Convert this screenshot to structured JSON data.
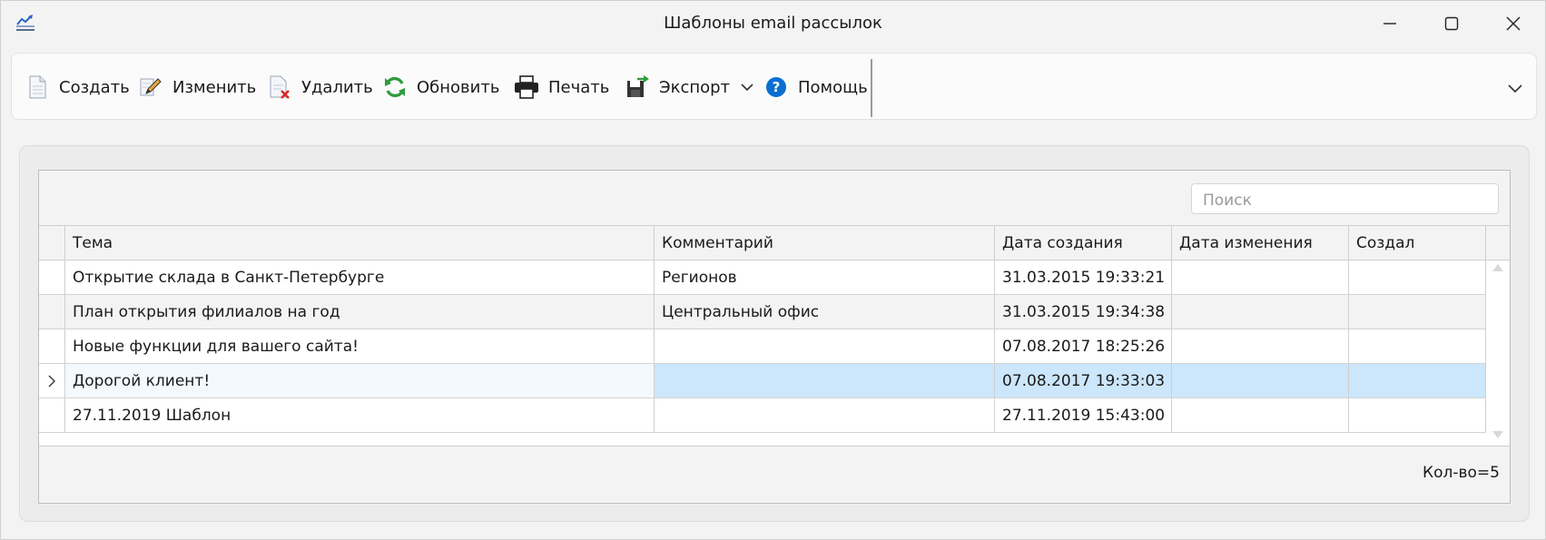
{
  "window": {
    "title": "Шаблоны email рассылок",
    "icon": "chart-app-icon"
  },
  "toolbar": {
    "items": [
      {
        "label": "Создать",
        "icon": "new-document-icon"
      },
      {
        "label": "Изменить",
        "icon": "edit-pencil-icon"
      },
      {
        "label": "Удалить",
        "icon": "delete-document-icon"
      },
      {
        "label": "Обновить",
        "icon": "refresh-icon"
      },
      {
        "label": "Печать",
        "icon": "printer-icon"
      },
      {
        "label": "Экспорт",
        "icon": "export-icon"
      },
      {
        "label": "Помощь",
        "icon": "help-icon"
      }
    ]
  },
  "search": {
    "placeholder": "Поиск"
  },
  "table": {
    "columns": [
      "Тема",
      "Комментарий",
      "Дата создания",
      "Дата изменения",
      "Создал"
    ],
    "rows": [
      {
        "subject": "Открытие склада в Санкт-Петербурге",
        "comment": "Регионов",
        "created": "31.03.2015 19:33:21",
        "modified": "",
        "author": ""
      },
      {
        "subject": "План открытия филиалов на год",
        "comment": "Центральный офис",
        "created": "31.03.2015 19:34:38",
        "modified": "",
        "author": ""
      },
      {
        "subject": "Новые функции для вашего сайта!",
        "comment": "",
        "created": "07.08.2017 18:25:26",
        "modified": "",
        "author": ""
      },
      {
        "subject": "Дорогой клиент!",
        "comment": "",
        "created": "07.08.2017 19:33:03",
        "modified": "",
        "author": ""
      },
      {
        "subject": "27.11.2019 Шаблон",
        "comment": "",
        "created": "27.11.2019 15:43:00",
        "modified": "",
        "author": ""
      }
    ],
    "selected_row": 3
  },
  "footer": {
    "count": "Кол-во=5"
  },
  "colors": {
    "selection": "#cce6fb",
    "accent": "#0078d4"
  }
}
